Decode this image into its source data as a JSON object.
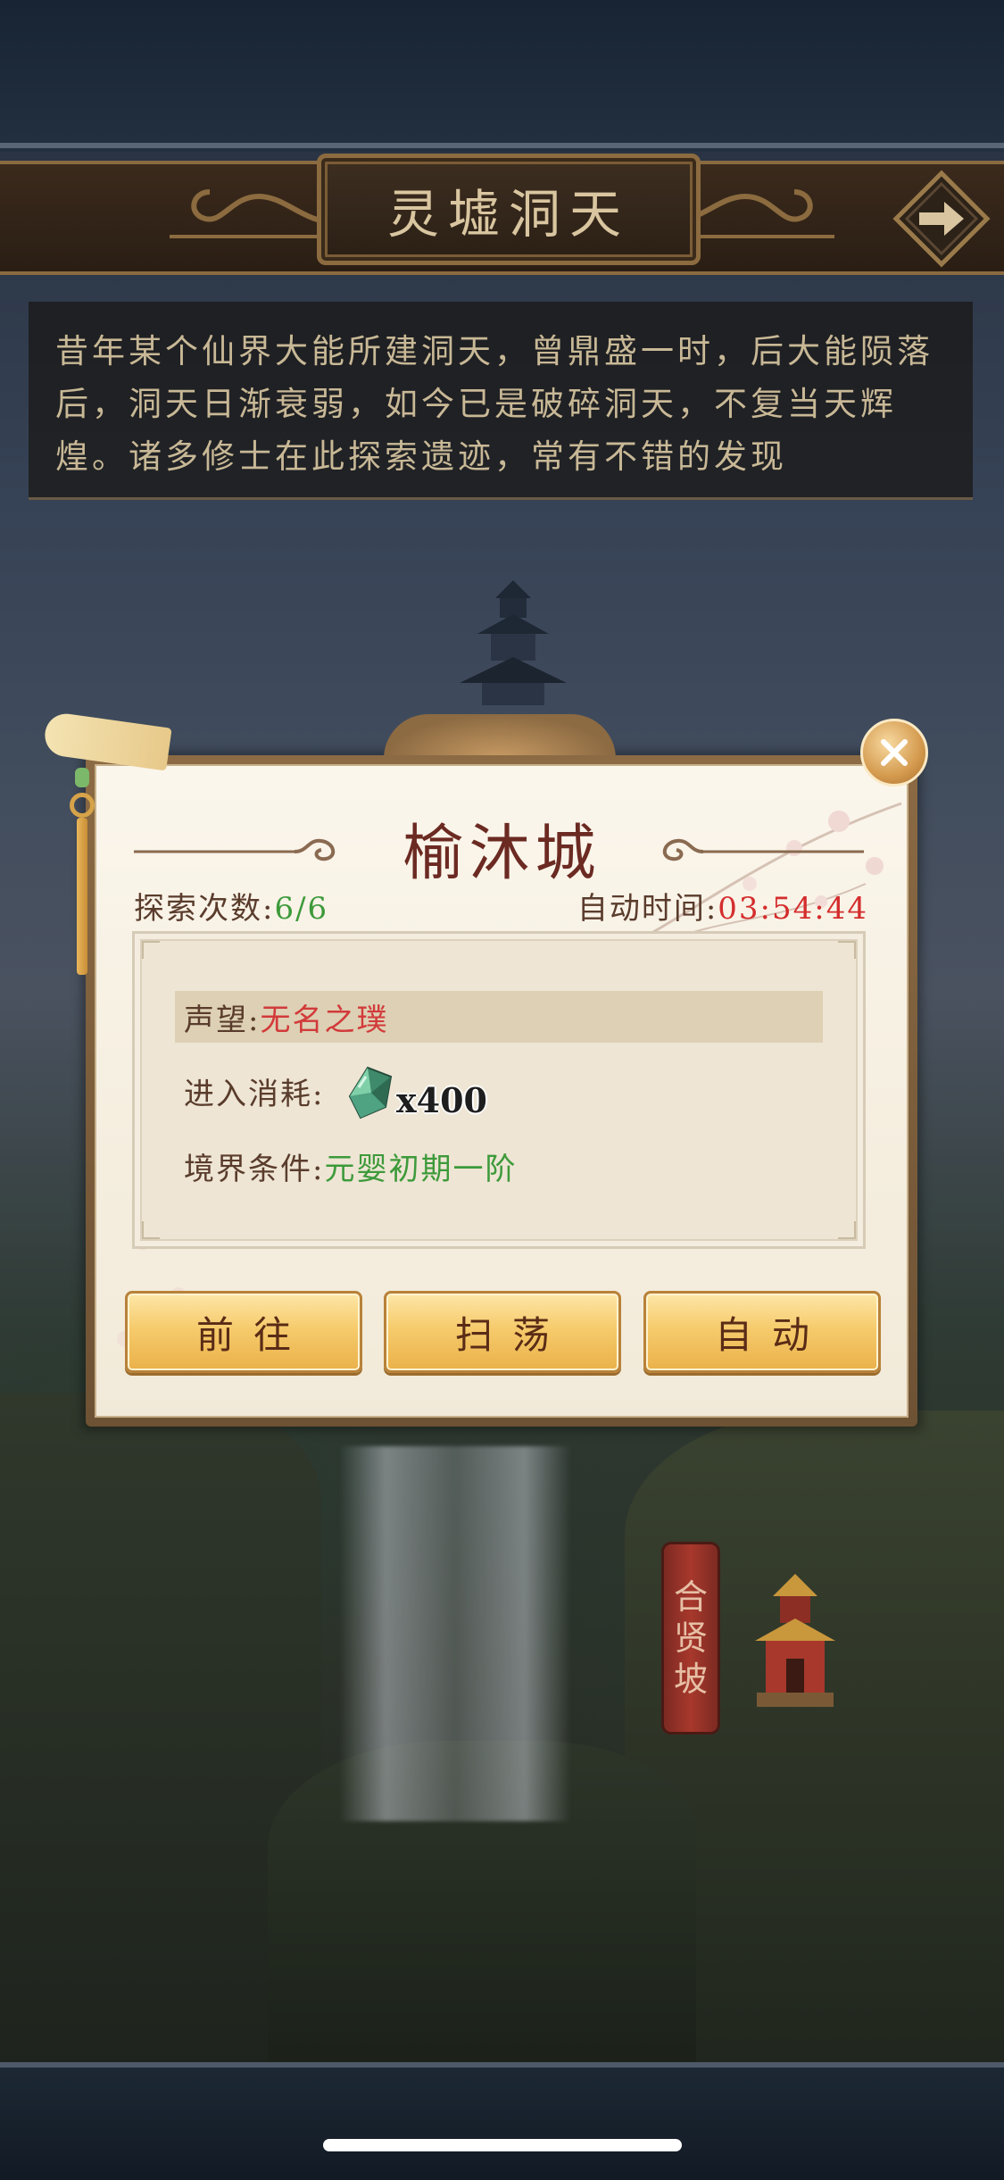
{
  "location": {
    "title": "灵墟洞天",
    "description": "昔年某个仙界大能所建洞天，曾鼎盛一时，后大能陨落后，洞天日渐衰弱，如今已是破碎洞天，不复当天辉煌。诸多修士在此探索遗迹，常有不错的发现"
  },
  "dialog": {
    "city_name": "榆沐城",
    "explore_label": "探索次数:",
    "explore_value": "6/6",
    "auto_time_label": "自动时间:",
    "auto_time_value": "03:54:44",
    "reputation_label": "声望:",
    "reputation_value": "无名之璞",
    "entry_cost_label": "进入消耗:",
    "entry_cost_item_icon": "green-spirit-stone-icon",
    "entry_cost_qty": "x400",
    "realm_label": "境界条件:",
    "realm_value": "元婴初期一阶",
    "buttons": {
      "go": "前往",
      "sweep": "扫荡",
      "auto": "自动"
    }
  },
  "map": {
    "signpost_label": [
      "合",
      "贤",
      "坡"
    ]
  },
  "colors": {
    "title_red": "#6b2a22",
    "value_green": "#3d9a3a",
    "value_red": "#d42d2d",
    "button_gold": "#f6cb6c"
  }
}
